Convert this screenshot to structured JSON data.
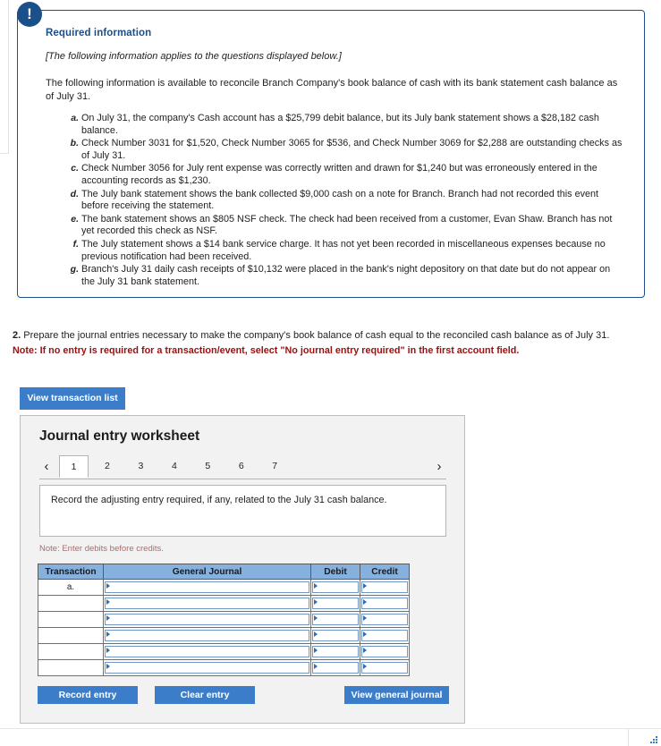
{
  "callout": {
    "badge_icon": "exclamation-icon",
    "badge_glyph": "!",
    "title": "Required information",
    "subtitle": "[The following information applies to the questions displayed below.]",
    "body": "The following information is available to reconcile Branch Company's book balance of cash with its bank statement cash balance as of July 31.",
    "items": [
      {
        "marker": "a.",
        "text": "On July 31, the company's Cash account has a $25,799 debit balance, but its July bank statement shows a $28,182 cash balance."
      },
      {
        "marker": "b.",
        "text": "Check Number 3031 for $1,520, Check Number 3065 for $536, and Check Number 3069 for $2,288 are outstanding checks as of July 31."
      },
      {
        "marker": "c.",
        "text": "Check Number 3056 for July rent expense was correctly written and drawn for $1,240 but was erroneously entered in the accounting records as $1,230."
      },
      {
        "marker": "d.",
        "text": "The July bank statement shows the bank collected $9,000 cash on a note for Branch. Branch had not recorded this event before receiving the statement."
      },
      {
        "marker": "e.",
        "text": "The bank statement shows an $805 NSF check. The check had been received from a customer, Evan Shaw. Branch has not yet recorded this check as NSF."
      },
      {
        "marker": "f.",
        "text": "The July statement shows a $14 bank service charge. It has not yet been recorded in miscellaneous expenses because no previous notification had been received."
      },
      {
        "marker": "g.",
        "text": "Branch's July 31 daily cash receipts of $10,132 were placed in the bank's night depository on that date but do not appear on the July 31 bank statement."
      }
    ]
  },
  "question": {
    "number": "2.",
    "text": "Prepare the journal entries necessary to make the company's book balance of cash equal to the reconciled cash balance as of July 31.",
    "note": "Note: If no entry is required for a transaction/event, select \"No journal entry required\" in the first account field."
  },
  "toolbar": {
    "view_transaction_list_label": "View transaction list"
  },
  "worksheet": {
    "title": "Journal entry worksheet",
    "prev_arrow_icon": "chevron-left-icon",
    "prev_arrow_glyph": "‹",
    "next_arrow_icon": "chevron-right-icon",
    "next_arrow_glyph": "›",
    "tabs": [
      "1",
      "2",
      "3",
      "4",
      "5",
      "6",
      "7"
    ],
    "active_tab": "1",
    "prompt": "Record the adjusting entry required, if any, related to the July 31 cash balance.",
    "note": "Note: Enter debits before credits.",
    "table": {
      "headers": [
        "Transaction",
        "General Journal",
        "Debit",
        "Credit"
      ],
      "rows": [
        {
          "transaction": "a.",
          "general_journal": "",
          "debit": "",
          "credit": ""
        },
        {
          "transaction": "",
          "general_journal": "",
          "debit": "",
          "credit": ""
        },
        {
          "transaction": "",
          "general_journal": "",
          "debit": "",
          "credit": ""
        },
        {
          "transaction": "",
          "general_journal": "",
          "debit": "",
          "credit": ""
        },
        {
          "transaction": "",
          "general_journal": "",
          "debit": "",
          "credit": ""
        },
        {
          "transaction": "",
          "general_journal": "",
          "debit": "",
          "credit": ""
        }
      ]
    },
    "buttons": {
      "record_entry": "Record entry",
      "clear_entry": "Clear entry",
      "view_general_journal": "View general journal"
    }
  },
  "colors": {
    "accent_blue": "#3c7dc9",
    "callout_border": "#1f4e8c",
    "badge_blue": "#1b4f8a",
    "note_red": "#9c0f0f",
    "ws_note_red": "#b06a6a",
    "table_header_blue": "#86b0de"
  }
}
